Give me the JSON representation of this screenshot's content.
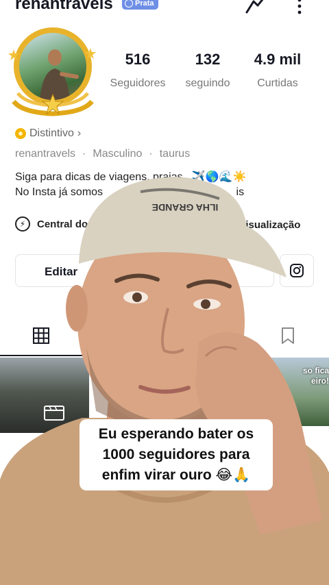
{
  "profile": {
    "username": "renantravels",
    "badge_label": "Prata",
    "distintivo_label": "Distintivo",
    "meta": [
      "renantravels",
      "Masculino",
      "taurus"
    ],
    "bio_line1": "Siga para dicas de viagens, praias.. ✈️🌎🌊☀️",
    "bio_line2": "No Insta já somos",
    "bio_line2_tail": "is"
  },
  "stats": [
    {
      "value": "516",
      "label": "Seguidores"
    },
    {
      "value": "132",
      "label": "seguindo"
    },
    {
      "value": "4.9 mil",
      "label": "Curtidas"
    }
  ],
  "actions": {
    "central_label": "Central do",
    "visualizacao_label": "visualização",
    "edit_label": "Editar"
  },
  "thumbnail": {
    "overlay_text_1": "so fica",
    "overlay_text_2": "eiro!"
  },
  "caption": {
    "line1": "Eu esperando bater os",
    "line2": "1000 seguidores para",
    "line3": "enfim virar ouro 😂🙏"
  },
  "colors": {
    "gold_frame": "#e8b32b",
    "badge_blue": "#6f8fe6",
    "cap": "#d9d2c1",
    "shirt": "#c9a27c",
    "skin": "#d9a584"
  }
}
